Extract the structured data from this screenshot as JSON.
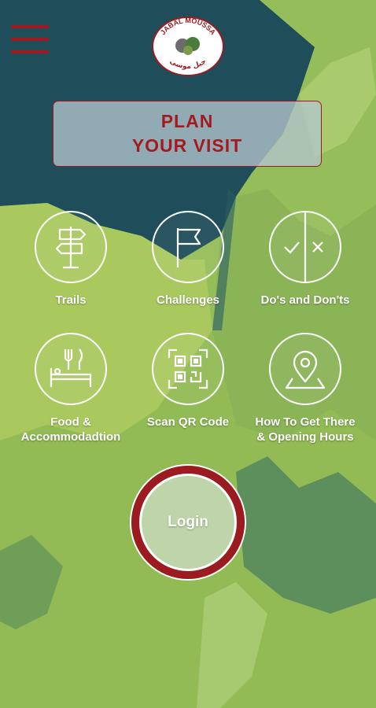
{
  "header": {
    "logo_text_top": "JABAL MOUSSA",
    "logo_text_bottom": "جبل موسى",
    "menu_icon": "hamburger-menu-icon"
  },
  "plan_visit": {
    "line1": "PLAN",
    "line2": "YOUR VISIT"
  },
  "tiles": [
    {
      "label": "Trails",
      "icon": "signpost-icon"
    },
    {
      "label": "Challenges",
      "icon": "flag-icon"
    },
    {
      "label": "Do's and Don'ts",
      "icon": "check-cross-icon"
    },
    {
      "label_line1": "Food &",
      "label_line2": "Accommodadtion",
      "icon": "food-bed-icon"
    },
    {
      "label": "Scan QR Code",
      "icon": "qr-code-icon"
    },
    {
      "label_line1": "How To Get There",
      "label_line2": "& Opening Hours",
      "icon": "map-pin-icon"
    }
  ],
  "login": {
    "label": "Login"
  },
  "colors": {
    "accent": "#9b1b20",
    "sky": "#1f4d5a",
    "mountain": "#9cc45a"
  }
}
